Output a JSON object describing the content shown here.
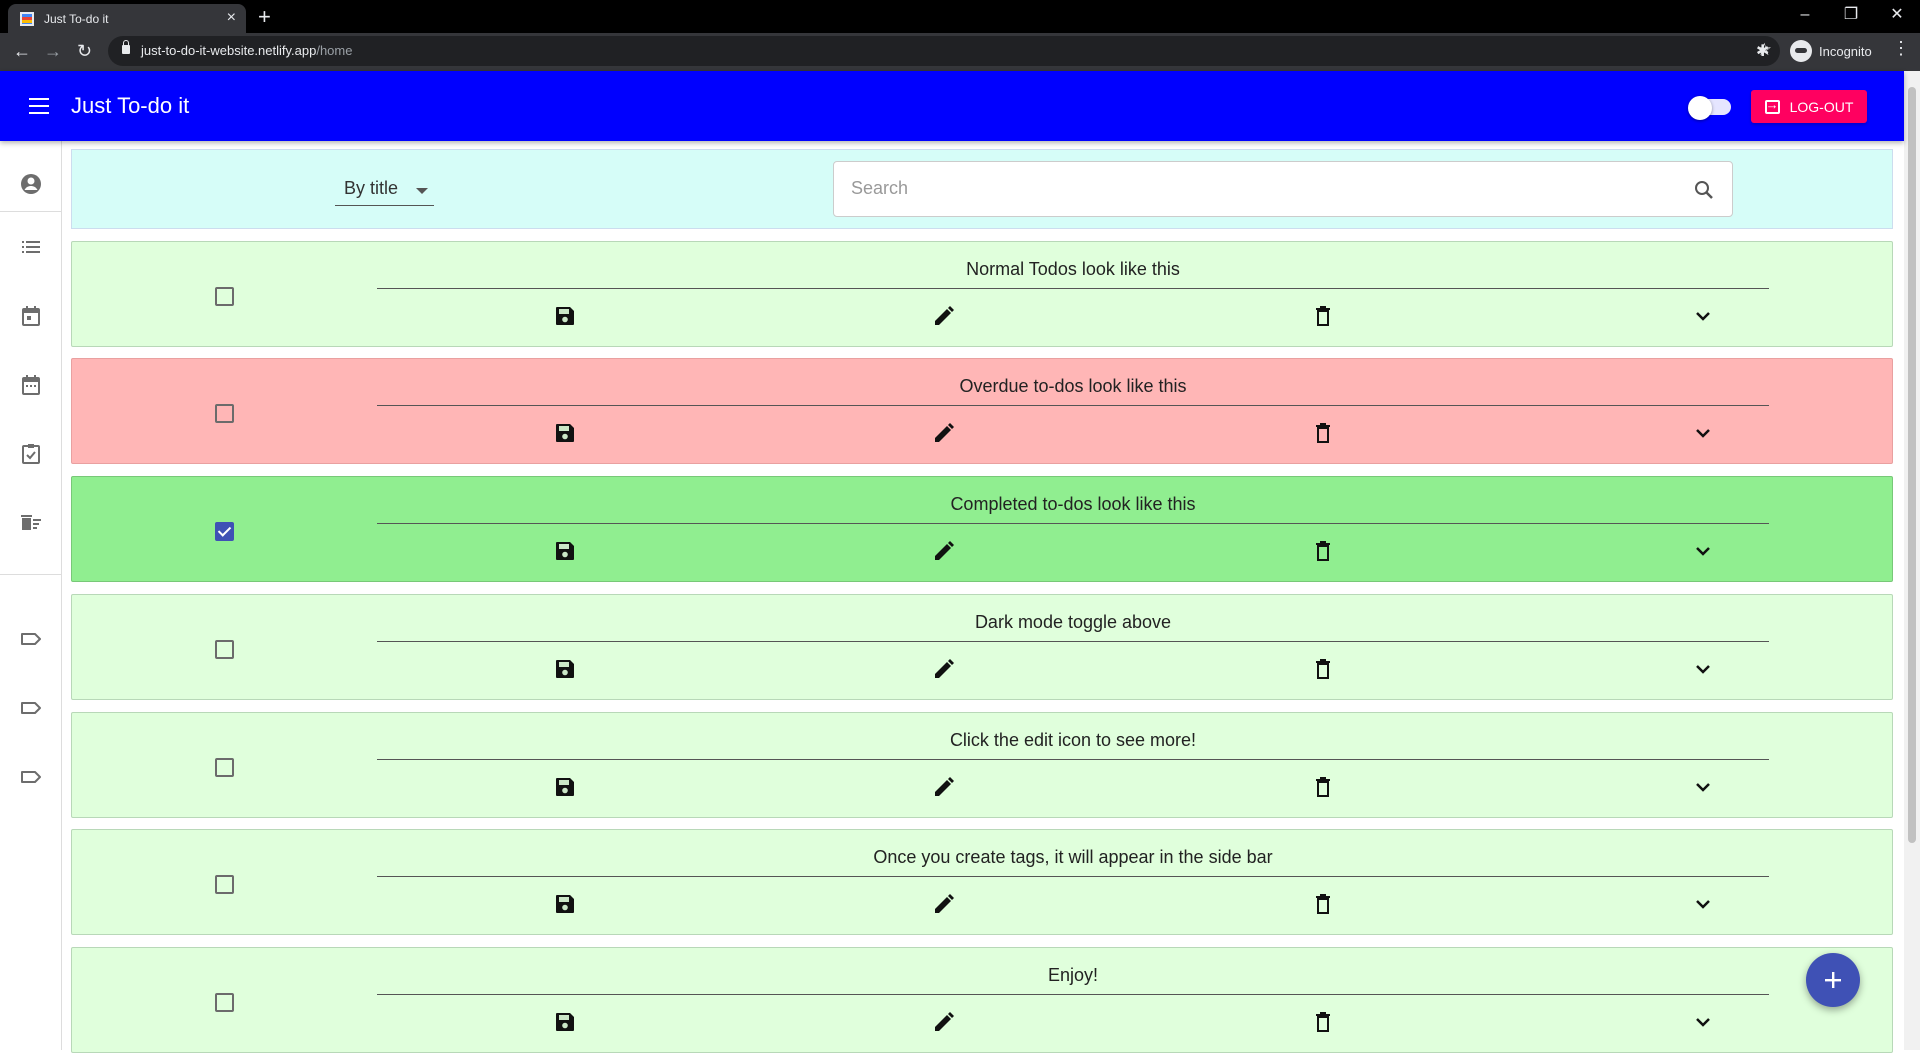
{
  "browser": {
    "tab_title": "Just To-do it",
    "url_host": "just-to-do-it-website.netlify.app",
    "url_path": "/home",
    "profile_label": "Incognito"
  },
  "app": {
    "title": "Just To-do it",
    "logout_label": "LOG-OUT",
    "accent_color": "#0000ff",
    "logout_color": "#ff0060"
  },
  "sidebar": {
    "items": [
      {
        "icon": "account-circle-icon"
      },
      {
        "icon": "list-icon"
      },
      {
        "icon": "calendar-today-icon"
      },
      {
        "icon": "calendar-month-icon"
      },
      {
        "icon": "assignment-check-icon"
      },
      {
        "icon": "delete-sweep-icon"
      },
      {
        "icon": "tag-icon"
      },
      {
        "icon": "tag-icon"
      },
      {
        "icon": "tag-icon"
      }
    ]
  },
  "filter": {
    "sort_label": "By title",
    "search_placeholder": "Search"
  },
  "todos": [
    {
      "title": "Normal Todos look like this",
      "status": "normal",
      "completed": false,
      "bg": "#e0ffdc"
    },
    {
      "title": "Overdue to-dos look like this",
      "status": "overdue",
      "completed": false,
      "bg": "#ffb6b6"
    },
    {
      "title": "Completed to-dos look like this",
      "status": "completed",
      "completed": true,
      "bg": "#90ee90"
    },
    {
      "title": "Dark mode toggle above",
      "status": "normal",
      "completed": false,
      "bg": "#e0ffdc"
    },
    {
      "title": "Click the edit icon to see more!",
      "status": "normal",
      "completed": false,
      "bg": "#e0ffdc"
    },
    {
      "title": "Once you create tags, it will appear in the side bar",
      "status": "normal",
      "completed": false,
      "bg": "#e0ffdc"
    },
    {
      "title": "Enjoy!",
      "status": "normal",
      "completed": false,
      "bg": "#e0ffdc"
    }
  ]
}
